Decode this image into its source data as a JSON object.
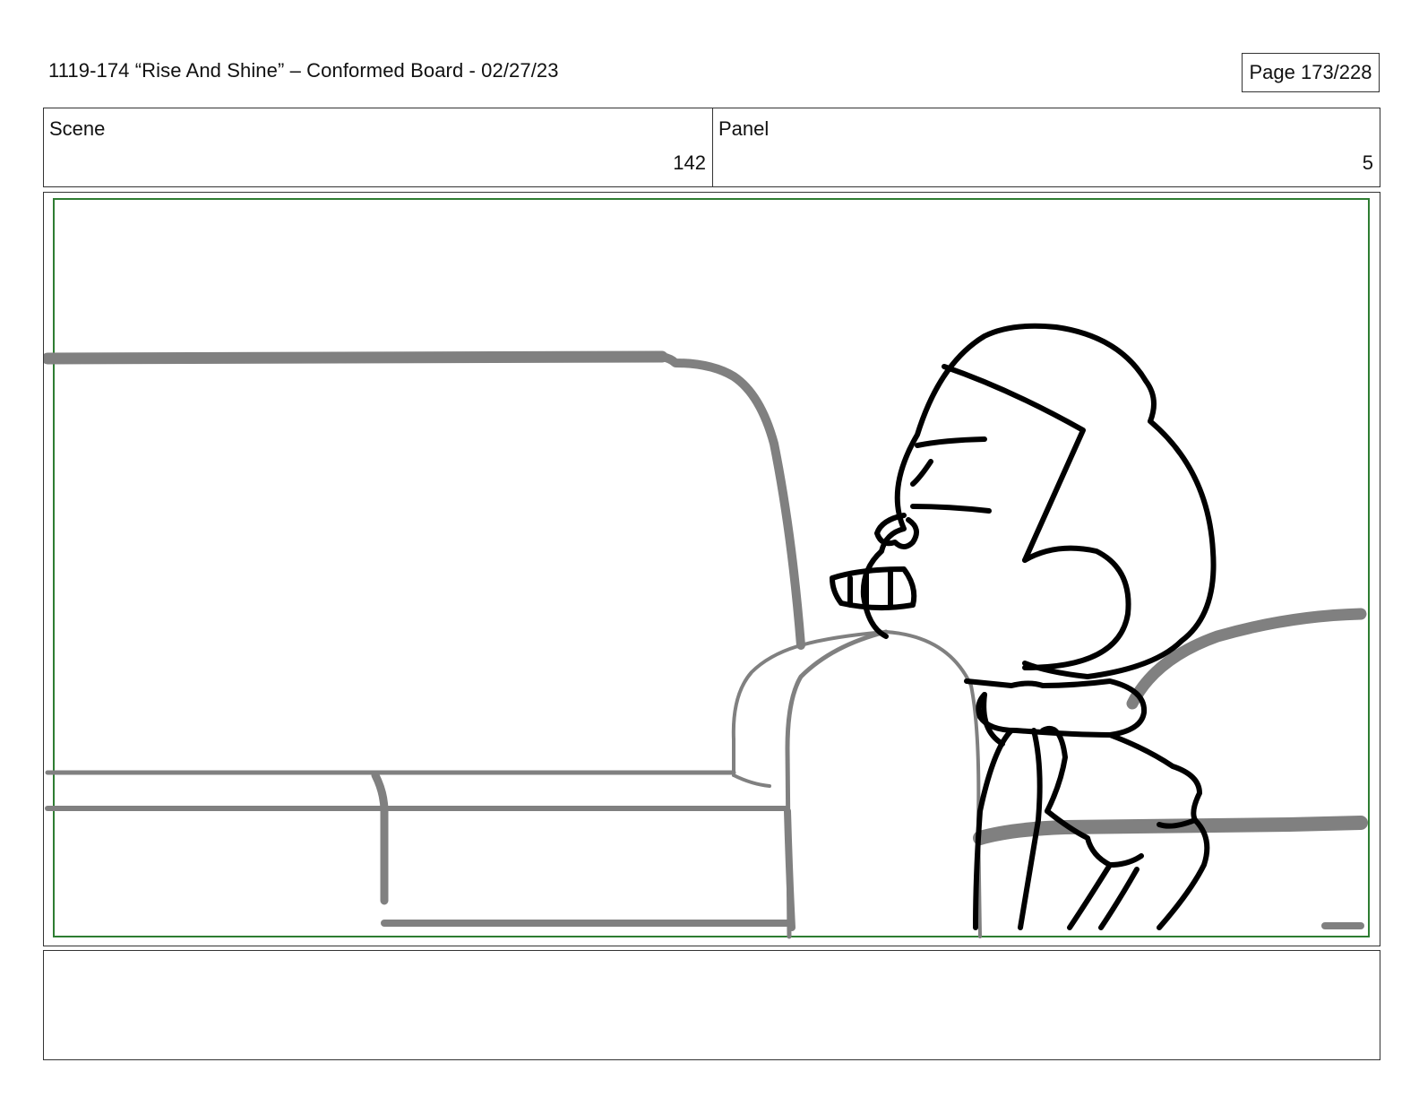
{
  "header": {
    "title": "1119-174 “Rise And Shine” – Conformed Board - 02/27/23",
    "page": "Page 173/228"
  },
  "info": {
    "scene_label": "Scene",
    "scene_value": "142",
    "panel_label": "Panel",
    "panel_value": "5"
  },
  "notes": {
    "text": ""
  },
  "colors": {
    "safe_area": "#2e7d32",
    "background_lines": "#808080",
    "character_lines": "#000000"
  }
}
